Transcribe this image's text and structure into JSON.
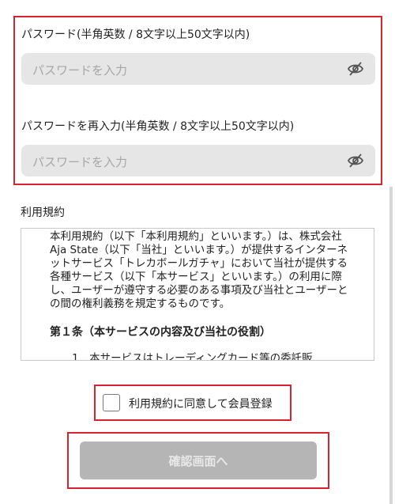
{
  "password": {
    "label": "パスワード(半角英数 / 8文字以上50文字以内)",
    "placeholder": "パスワードを入力",
    "eye_icon": "eye-slash-icon"
  },
  "password_confirm": {
    "label": "パスワードを再入力(半角英数 / 8文字以上50文字以内)",
    "placeholder": "パスワードを入力",
    "eye_icon": "eye-slash-icon"
  },
  "terms": {
    "title": "利用規約",
    "intro": "本利用規約（以下「本利用規約」といいます。）は、株式会社Aja State（以下「当社」といいます。）が提供するインターネットサービス「トレカボールガチャ」において当社が提供する各種サービス（以下「本サービス」といいます。）の利用に際し、ユーザーが遵守する必要のある事項及び当社とユーザーとの間の権利義務を規定するものです。",
    "article1_heading": "第１条（本サービスの内容及び当社の役割）",
    "article1_item1": "1．本サービスはトレーディングカード等の委託販"
  },
  "agree": {
    "label": "利用規約に同意して会員登録",
    "checked": false
  },
  "confirm_button": {
    "label": "確認画面へ",
    "enabled": false
  },
  "colors": {
    "highlight_border": "#d9232f",
    "input_bg": "#e6e6e6",
    "button_disabled_bg": "#b5b5b5"
  }
}
